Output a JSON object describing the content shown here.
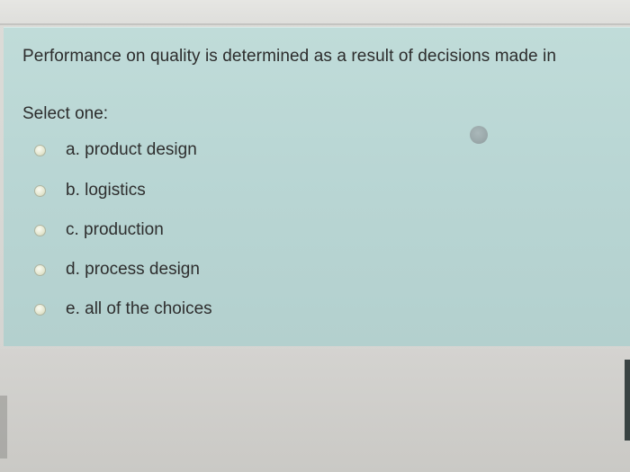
{
  "question": {
    "text": "Performance on quality is determined as a result of decisions made in",
    "prompt": "Select one:",
    "options": [
      {
        "label": "a. product design"
      },
      {
        "label": "b. logistics"
      },
      {
        "label": "c. production"
      },
      {
        "label": "d. process design"
      },
      {
        "label": "e. all of the choices"
      }
    ]
  },
  "colors": {
    "panel": "#bcd8d6",
    "page": "#d6d6d3",
    "text": "#2c2c2c"
  }
}
